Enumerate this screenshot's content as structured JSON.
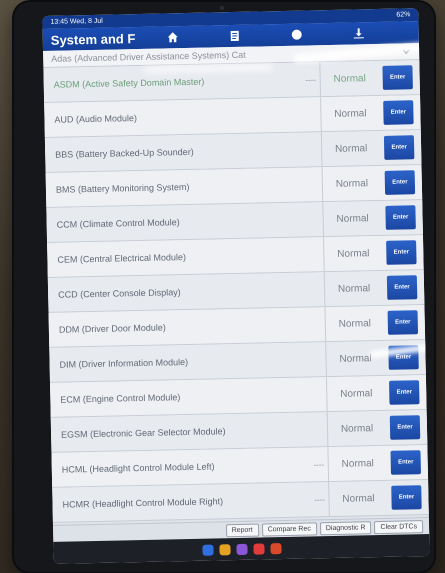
{
  "status_bar": {
    "left": "13:45 Wed, 8 Jul",
    "right": "62%"
  },
  "title_bar": {
    "title": "System and F",
    "icons": [
      "home-icon",
      "document-icon",
      "help-icon",
      "export-icon"
    ]
  },
  "dropdown": {
    "text": "Adas (Advanced Driver Assistance Systems) Cat"
  },
  "modules": [
    {
      "name": "ASDM (Active Safety Domain Master)",
      "dash": "----",
      "status": "Normal",
      "enter": "Enter",
      "green": true
    },
    {
      "name": "AUD (Audio Module)",
      "dash": "",
      "status": "Normal",
      "enter": "Enter",
      "green": false
    },
    {
      "name": "BBS (Battery Backed-Up Sounder)",
      "dash": "",
      "status": "Normal",
      "enter": "Enter",
      "green": false
    },
    {
      "name": "BMS (Battery Monitoring System)",
      "dash": "",
      "status": "Normal",
      "enter": "Enter",
      "green": false
    },
    {
      "name": "CCM (Climate Control Module)",
      "dash": "",
      "status": "Normal",
      "enter": "Enter",
      "green": false
    },
    {
      "name": "CEM (Central Electrical Module)",
      "dash": "",
      "status": "Normal",
      "enter": "Enter",
      "green": false
    },
    {
      "name": "CCD (Center Console Display)",
      "dash": "",
      "status": "Normal",
      "enter": "Enter",
      "green": false
    },
    {
      "name": "DDM (Driver Door Module)",
      "dash": "",
      "status": "Normal",
      "enter": "Enter",
      "green": false
    },
    {
      "name": "DIM (Driver Information Module)",
      "dash": "",
      "status": "Normal",
      "enter": "Enter",
      "green": false
    },
    {
      "name": "ECM (Engine Control Module)",
      "dash": "",
      "status": "Normal",
      "enter": "Enter",
      "green": false
    },
    {
      "name": "EGSM (Electronic Gear Selector Module)",
      "dash": "",
      "status": "Normal",
      "enter": "Enter",
      "green": false
    },
    {
      "name": "HCML (Headlight Control Module Left)",
      "dash": "----",
      "status": "Normal",
      "enter": "Enter",
      "green": false
    },
    {
      "name": "HCMR (Headlight Control Module Right)",
      "dash": "----",
      "status": "Normal",
      "enter": "Enter",
      "green": false
    }
  ],
  "footer": {
    "report": "Report",
    "compare": "Compare Rec",
    "diagnostic": "Diagnostic R",
    "clear": "Clear DTCs"
  },
  "dock_colors": [
    "#2f6fe0",
    "#e6a323",
    "#8a57d8",
    "#e23b3b",
    "#d84a2a"
  ]
}
